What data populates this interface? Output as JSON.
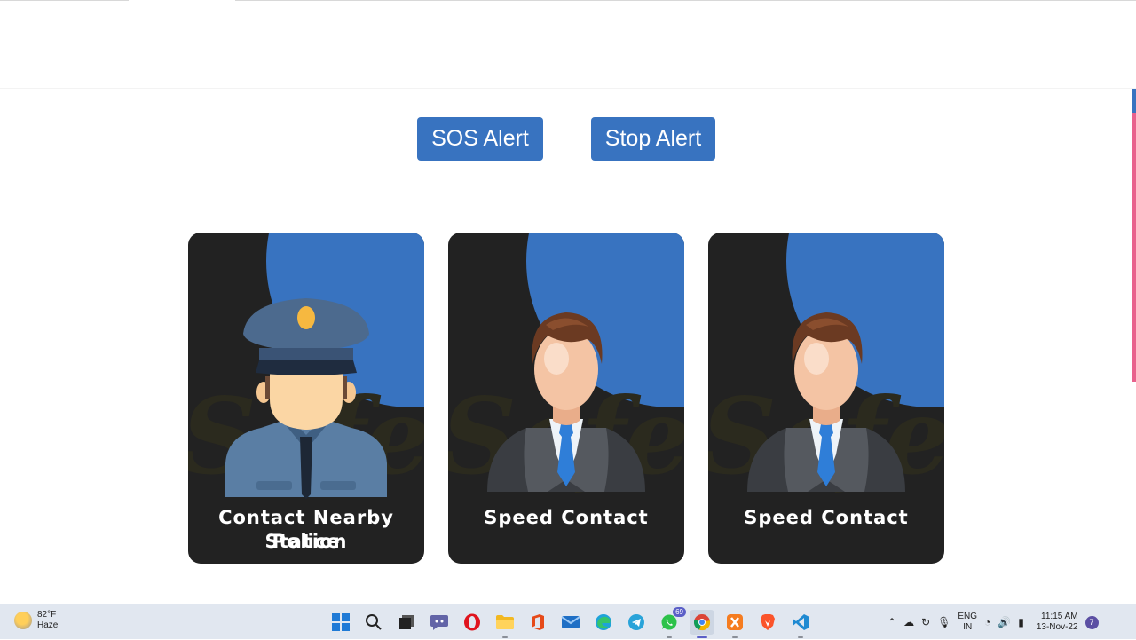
{
  "buttons": {
    "sos": "SOS Alert",
    "stop": "Stop Alert"
  },
  "cards": [
    {
      "label_line1": "Contact Nearby Police",
      "label_line2": "Station",
      "figure": "police-officer-icon"
    },
    {
      "label_line1": "Speed Contact",
      "label_line2": "",
      "figure": "businessman-icon"
    },
    {
      "label_line1": "Speed Contact",
      "label_line2": "",
      "figure": "businessman-icon"
    }
  ],
  "taskbar": {
    "weather_temp": "82°F",
    "weather_desc": "Haze",
    "whatsapp_badge": "69",
    "lang_line1": "ENG",
    "lang_line2": "IN",
    "time": "11:15 AM",
    "date": "13-Nov-22",
    "notifications": "7"
  },
  "colors": {
    "accent": "#3873c0",
    "card_bg": "#222222",
    "scroll_pink": "#e8628d"
  }
}
